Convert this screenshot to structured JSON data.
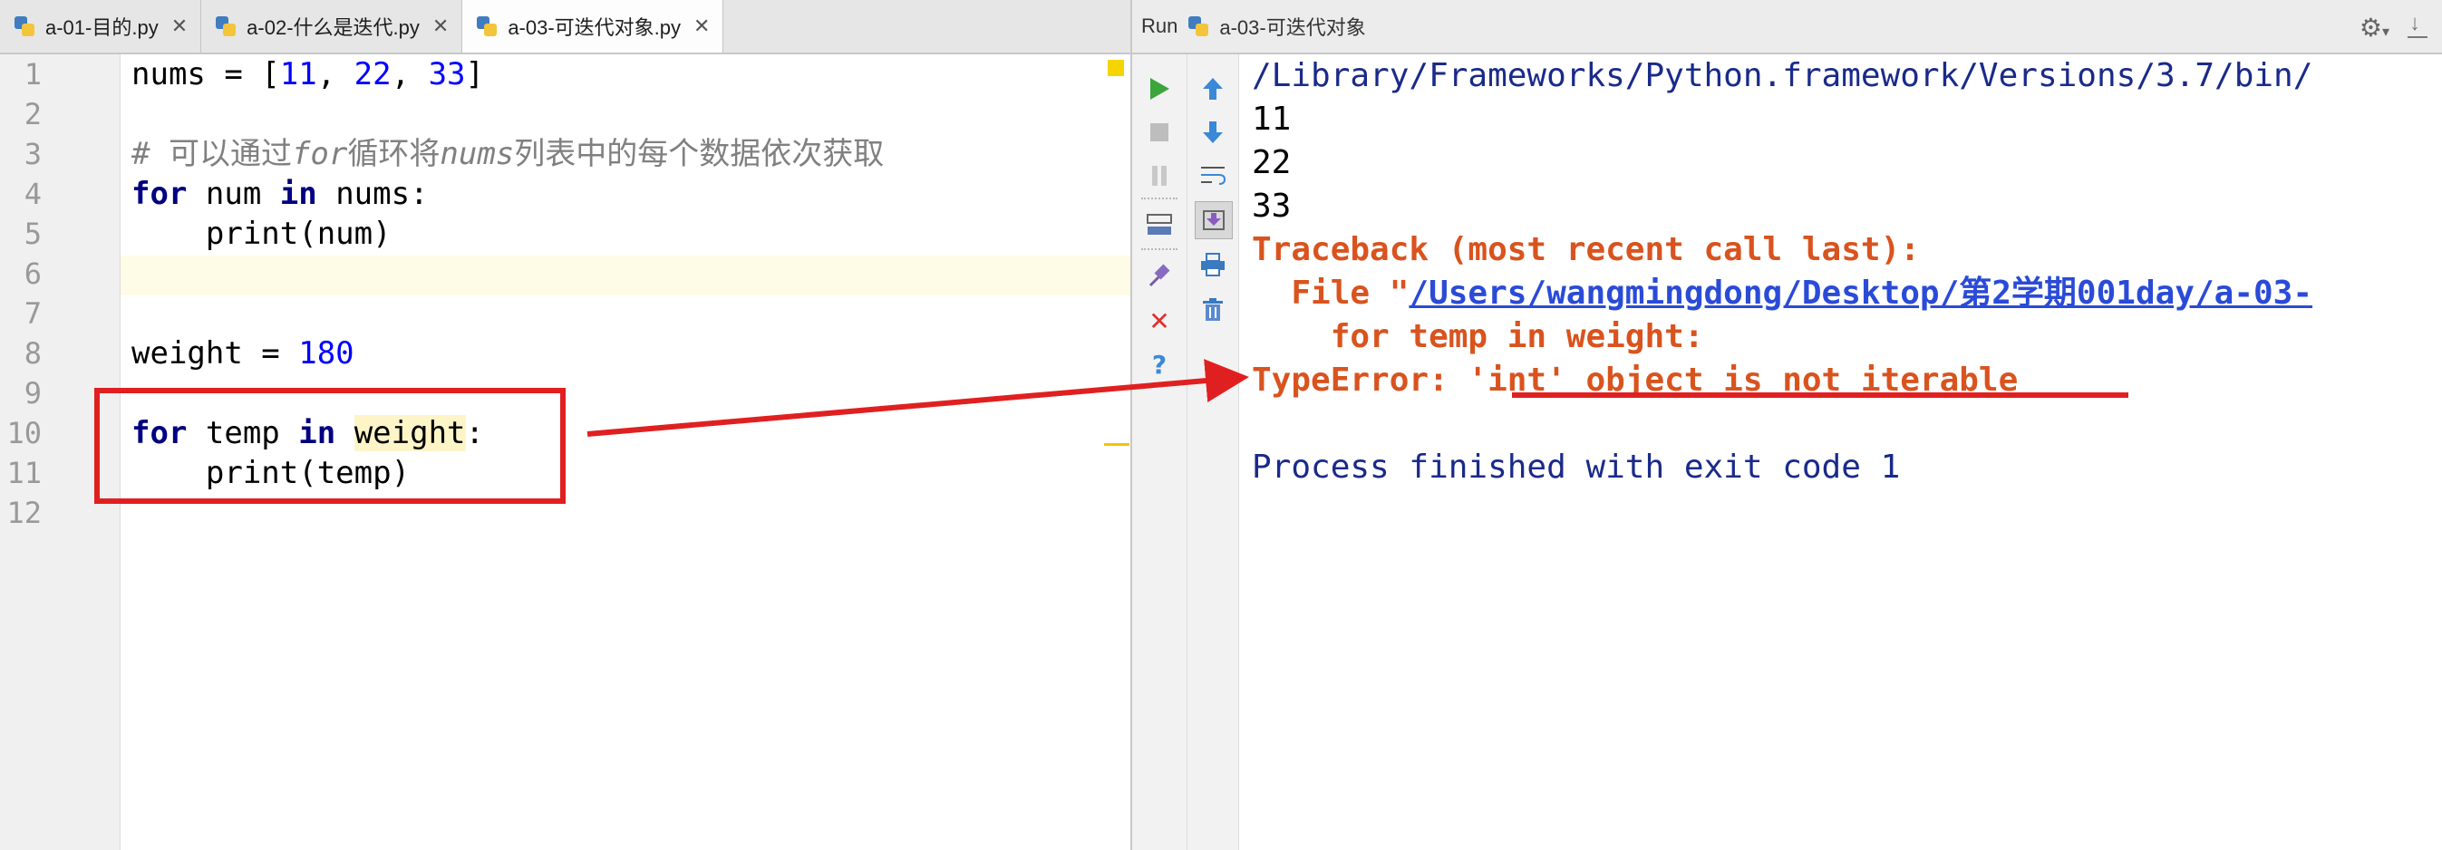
{
  "editor": {
    "tabs": [
      {
        "label": "a-01-目的.py",
        "close": "✕",
        "active": false
      },
      {
        "label": "a-02-什么是迭代.py",
        "close": "✕",
        "active": false
      },
      {
        "label": "a-03-可迭代对象.py",
        "close": "✕",
        "active": true
      }
    ],
    "line_numbers": [
      "1",
      "2",
      "3",
      "4",
      "5",
      "6",
      "7",
      "8",
      "9",
      "10",
      "11",
      "12"
    ],
    "code": {
      "l1": {
        "a": "nums = [",
        "n1": "11",
        "c1": ", ",
        "n2": "22",
        "c2": ", ",
        "n3": "33",
        "e": "]"
      },
      "l3": {
        "a": "# 可以通过",
        "i1": "for",
        "b": "循环将",
        "i2": "nums",
        "c": "列表中的每个数据依次获取"
      },
      "l4": {
        "kw1": "for",
        "a": " num ",
        "kw2": "in",
        "b": " nums:"
      },
      "l5": {
        "a": "    print(num)"
      },
      "l8": {
        "a": "weight = ",
        "n": "180"
      },
      "l10": {
        "kw1": "for",
        "a": " temp ",
        "kw2": "in",
        "sp": " ",
        "hl": "weight",
        "b": ":"
      },
      "l11": {
        "a": "    print(temp)"
      }
    }
  },
  "run": {
    "label": "Run",
    "config": "a-03-可迭代对象",
    "toolbar_left": [
      "run-icon",
      "stop-icon",
      "pause-icon",
      "layout-icon",
      "pin-icon",
      "close-icon",
      "help-icon"
    ],
    "toolbar_right": [
      "up-arrow-icon",
      "down-arrow-icon",
      "soft-wrap-icon",
      "scroll-to-end-icon",
      "print-icon",
      "trash-icon"
    ],
    "output": {
      "path": "/Library/Frameworks/Python.framework/Versions/3.7/bin/",
      "lines": [
        "11",
        "22",
        "33"
      ],
      "traceback": "Traceback (most recent call last):",
      "file_prefix": "  File \"",
      "file_link": "/Users/wangmingdong/Desktop/第2学期001day/a-03-",
      "source_line": "    for temp in weight:",
      "error": "TypeError: 'int' object is not iterable",
      "exit": "Process finished with exit code 1"
    }
  },
  "colors": {
    "annotation": "#e02020",
    "error_text": "#d9531e",
    "keyword": "#000080",
    "number": "#0000ff",
    "link": "#2a4bd7"
  }
}
